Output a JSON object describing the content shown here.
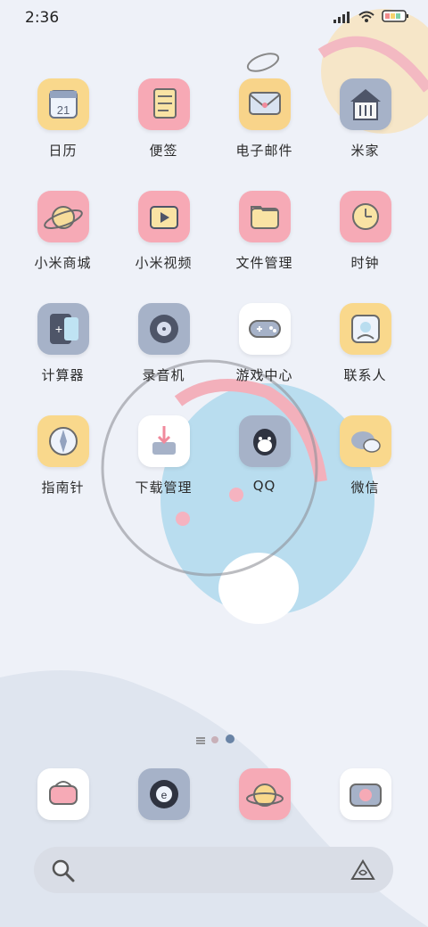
{
  "status_bar": {
    "time": "2:36",
    "signal_icon": "signal-bars-icon",
    "wifi_icon": "wifi-icon",
    "battery_icon": "battery-icon"
  },
  "apps": [
    {
      "label": "日历",
      "icon": "calendar-icon",
      "color": "#f9d88c",
      "glyph": "21"
    },
    {
      "label": "便签",
      "icon": "notes-icon",
      "color": "#f7a9b5",
      "glyph": ""
    },
    {
      "label": "电子邮件",
      "icon": "mail-icon",
      "color": "#f8d48a",
      "glyph": ""
    },
    {
      "label": "米家",
      "icon": "home-icon",
      "color": "#a6b2c8",
      "glyph": ""
    },
    {
      "label": "小米商城",
      "icon": "store-icon",
      "color": "#f6aab6",
      "glyph": ""
    },
    {
      "label": "小米视频",
      "icon": "video-icon",
      "color": "#f7a9b5",
      "glyph": ""
    },
    {
      "label": "文件管理",
      "icon": "folder-icon",
      "color": "#f6aab6",
      "glyph": ""
    },
    {
      "label": "时钟",
      "icon": "clock-icon",
      "color": "#f6aab6",
      "glyph": ""
    },
    {
      "label": "计算器",
      "icon": "calculator-icon",
      "color": "#a6b2c8",
      "glyph": ""
    },
    {
      "label": "录音机",
      "icon": "recorder-icon",
      "color": "#a6b2c8",
      "glyph": ""
    },
    {
      "label": "游戏中心",
      "icon": "gamepad-icon",
      "color": "#ffffff",
      "glyph": ""
    },
    {
      "label": "联系人",
      "icon": "contacts-icon",
      "color": "#f9d88c",
      "glyph": ""
    },
    {
      "label": "指南针",
      "icon": "compass-icon",
      "color": "#f9d88c",
      "glyph": ""
    },
    {
      "label": "下载管理",
      "icon": "download-icon",
      "color": "#ffffff",
      "glyph": ""
    },
    {
      "label": "QQ",
      "icon": "qq-icon",
      "color": "#a6b2c8",
      "glyph": ""
    },
    {
      "label": "微信",
      "icon": "wechat-icon",
      "color": "#f9d88c",
      "glyph": ""
    }
  ],
  "dock": [
    {
      "icon": "phone-icon",
      "color": "#ffffff"
    },
    {
      "icon": "browser-icon",
      "color": "#a6b2c8"
    },
    {
      "icon": "themes-icon",
      "color": "#f6aab6"
    },
    {
      "icon": "camera-icon",
      "color": "#ffffff"
    }
  ],
  "search_bar": {
    "search_icon": "search-icon",
    "assistant_icon": "assistant-icon"
  }
}
